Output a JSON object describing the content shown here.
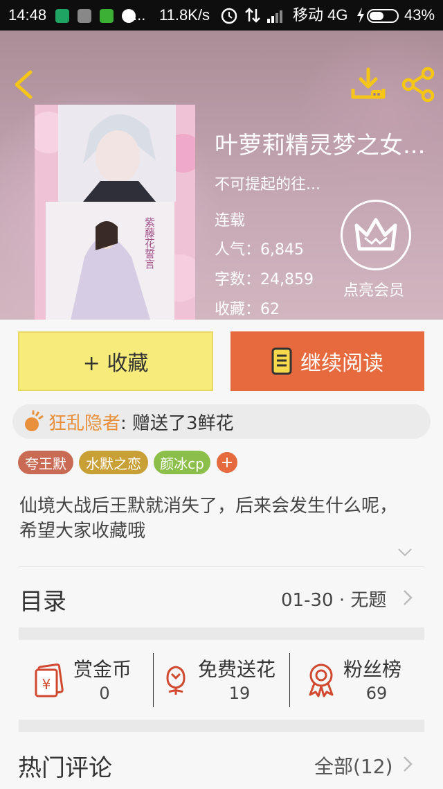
{
  "status_bar": {
    "time": "14:48",
    "dots": "...",
    "speed": "11.8K/s",
    "carrier": "移动 4G",
    "battery": "43%"
  },
  "book": {
    "title": "叶萝莉精灵梦之女...",
    "author": "不可提起的往...",
    "status": "连载",
    "popularity_label": "人气：",
    "popularity": "6,845",
    "words_label": "字数：",
    "words": "24,859",
    "favorites_label": "收藏：",
    "favorites": "62",
    "cover_text": "紫藤花誓言"
  },
  "vip": {
    "label": "点亮会员"
  },
  "actions": {
    "favorite_label": "+ 收藏",
    "continue_label": "继续阅读"
  },
  "gift_notice": {
    "user": "狂乱隐者",
    "message": ": 赠送了3鲜花"
  },
  "tags": [
    {
      "label": "夸王默",
      "color": "#c96a55"
    },
    {
      "label": "水默之恋",
      "color": "#c8a036"
    },
    {
      "label": "颜冰cp",
      "color": "#8cbf4a"
    }
  ],
  "tag_add": "+",
  "description": "仙境大战后王默就消失了，后来会发生什么呢，希望大家收藏哦",
  "toc": {
    "label": "目录",
    "latest": "01-30 · 无题"
  },
  "metrics": [
    {
      "label": "赏金币",
      "value": "0",
      "icon": "red-envelope-yen-icon"
    },
    {
      "label": "免费送花",
      "value": "19",
      "icon": "flower-icon"
    },
    {
      "label": "粉丝榜",
      "value": "69",
      "icon": "medal-icon"
    }
  ],
  "hot_comments": {
    "label": "热门评论",
    "all_label": "全部(12)"
  },
  "colors": {
    "accent": "#e66a3d",
    "favorite_bg": "#f7ec79",
    "icon_red": "#d0492e",
    "header_icon_yellow": "#f5c518",
    "gift_user": "#e8903c"
  }
}
